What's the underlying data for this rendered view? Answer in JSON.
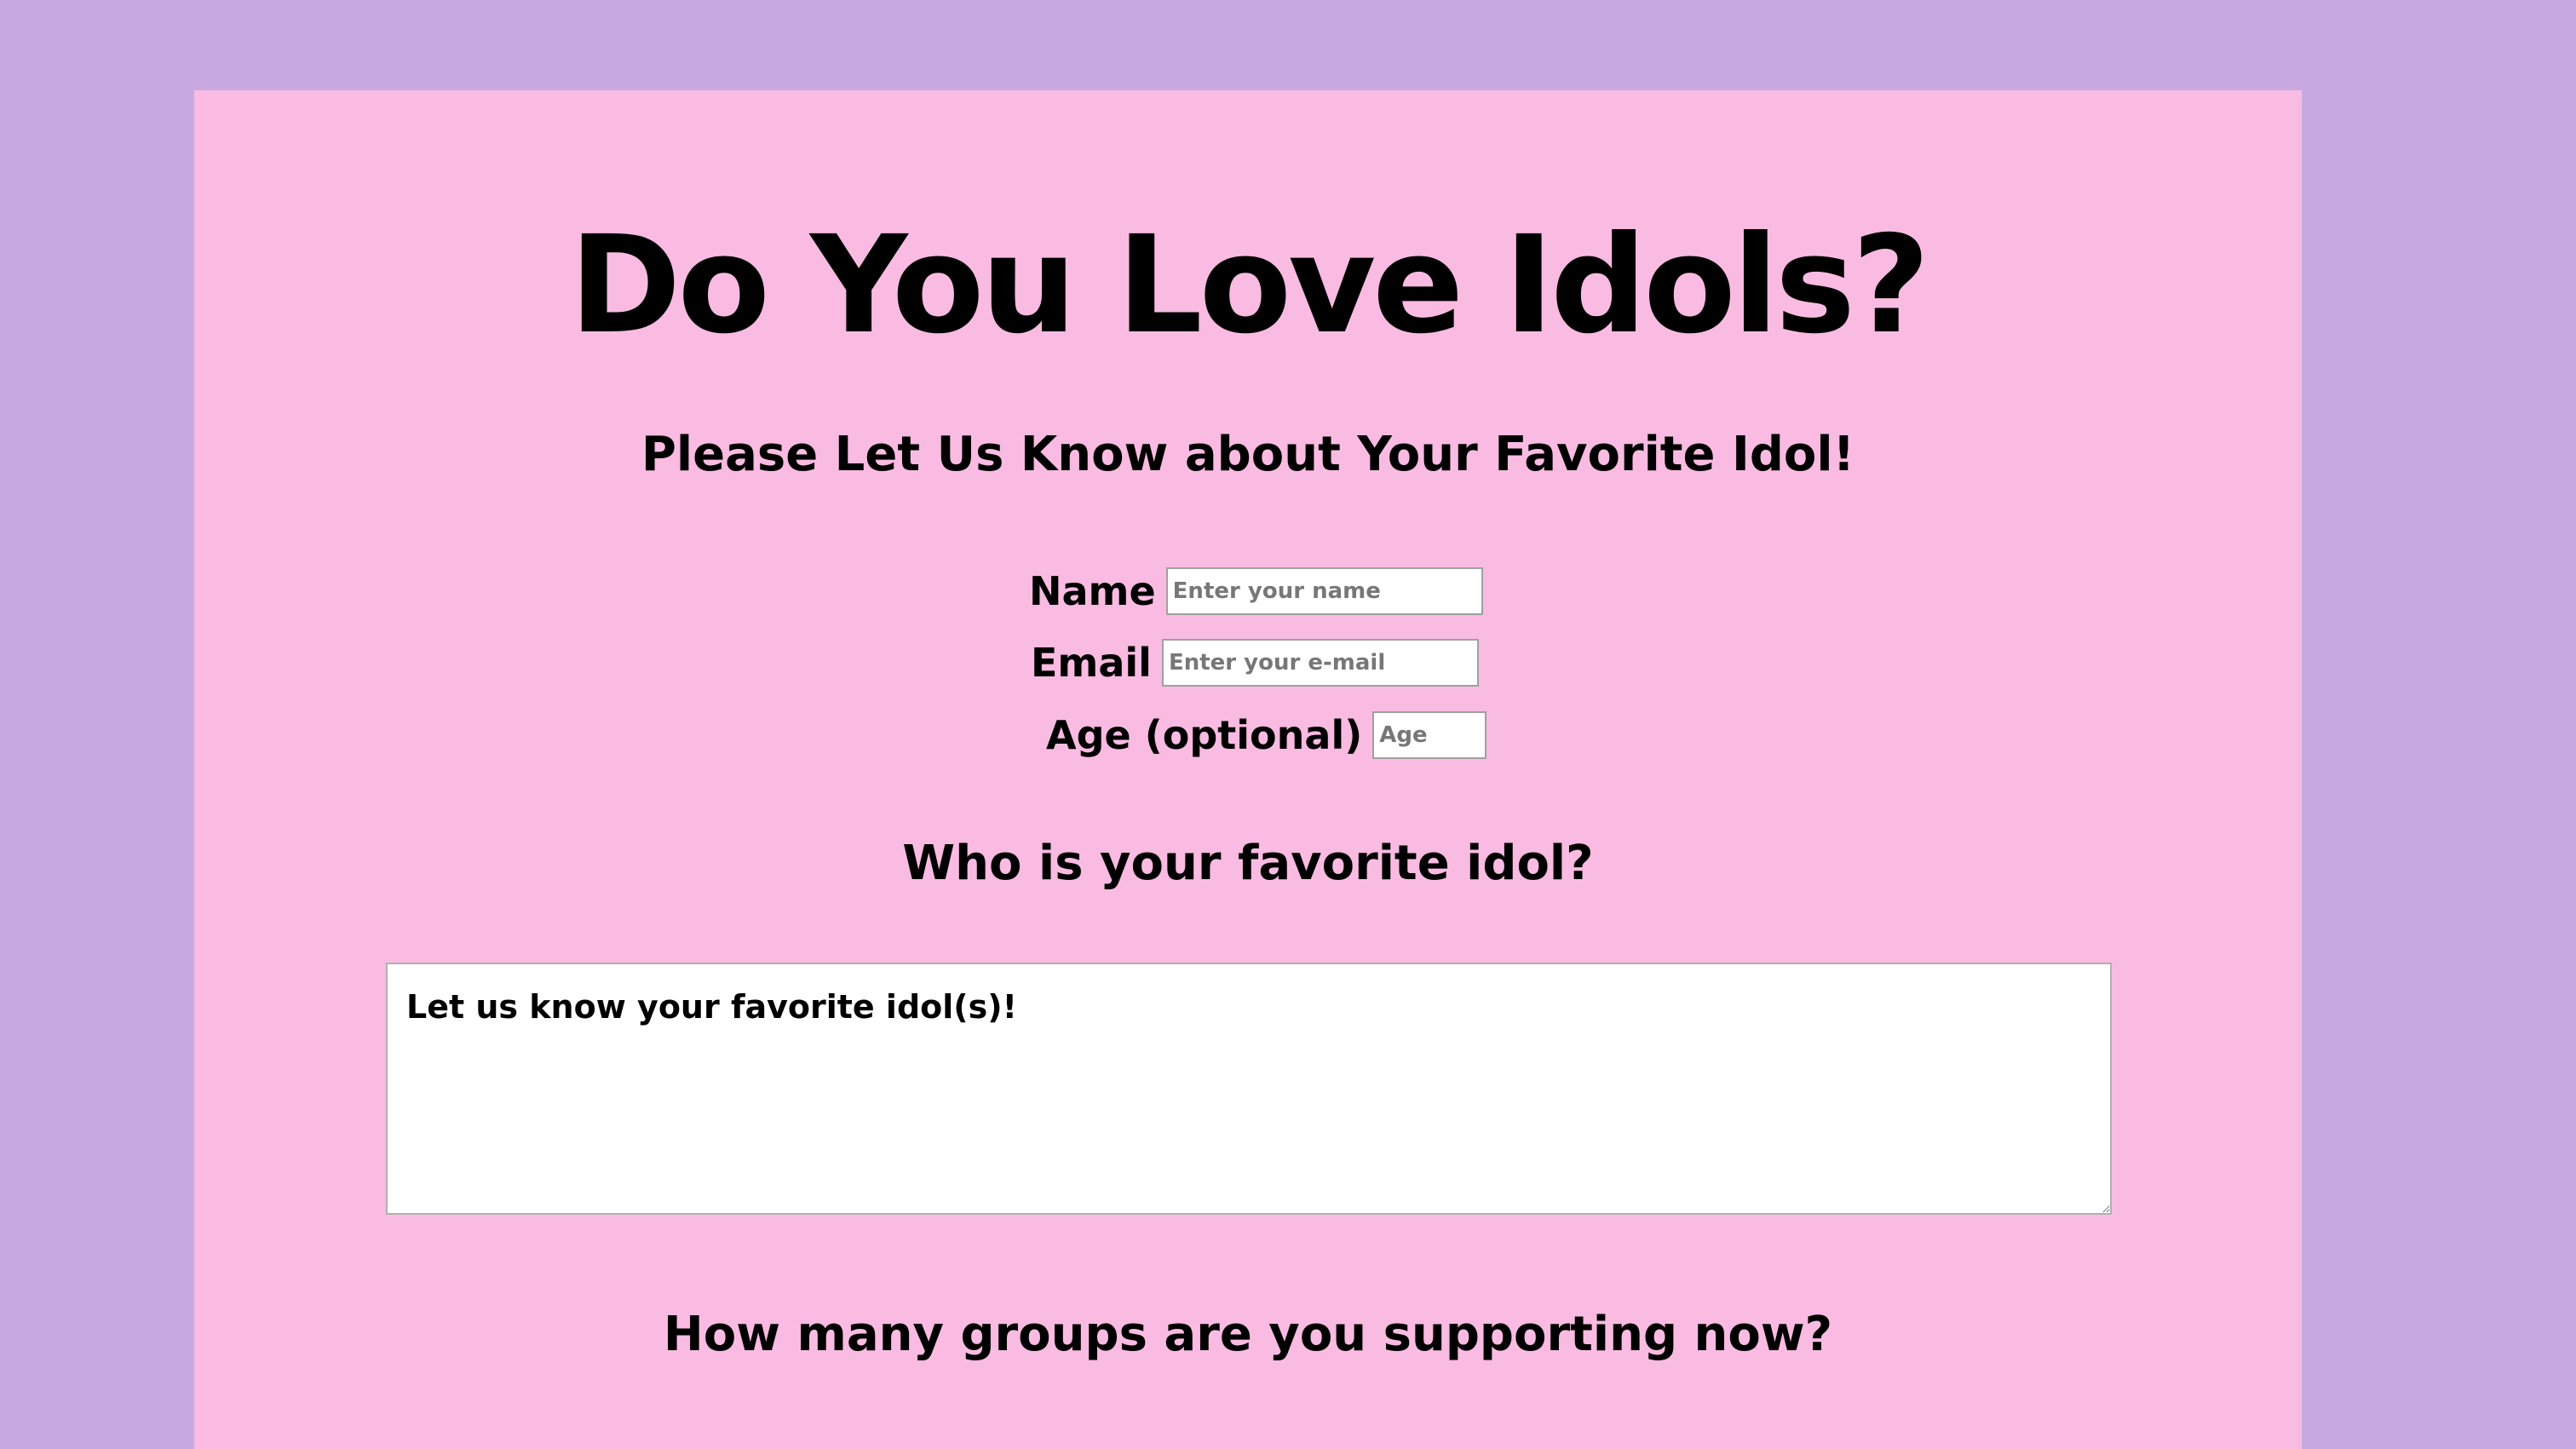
{
  "page": {
    "title": "Do You Love Idols?",
    "section_heading": "Please Let Us Know about Your Favorite Idol!",
    "favorite_heading": "Who is your favorite idol?",
    "groups_heading": "How many groups are you supporting now?"
  },
  "form": {
    "name": {
      "label": "Name",
      "placeholder": "Enter your name",
      "value": ""
    },
    "email": {
      "label": "Email",
      "placeholder": "Enter your e-mail",
      "value": ""
    },
    "age": {
      "label": "Age (optional)",
      "placeholder": "Age",
      "value": ""
    },
    "favorite_idol": {
      "placeholder": "Let us know your favorite idol(s)!",
      "value": ""
    }
  },
  "colors": {
    "background": "#c8aae0",
    "card": "#f9bbe1",
    "text": "#000000"
  }
}
